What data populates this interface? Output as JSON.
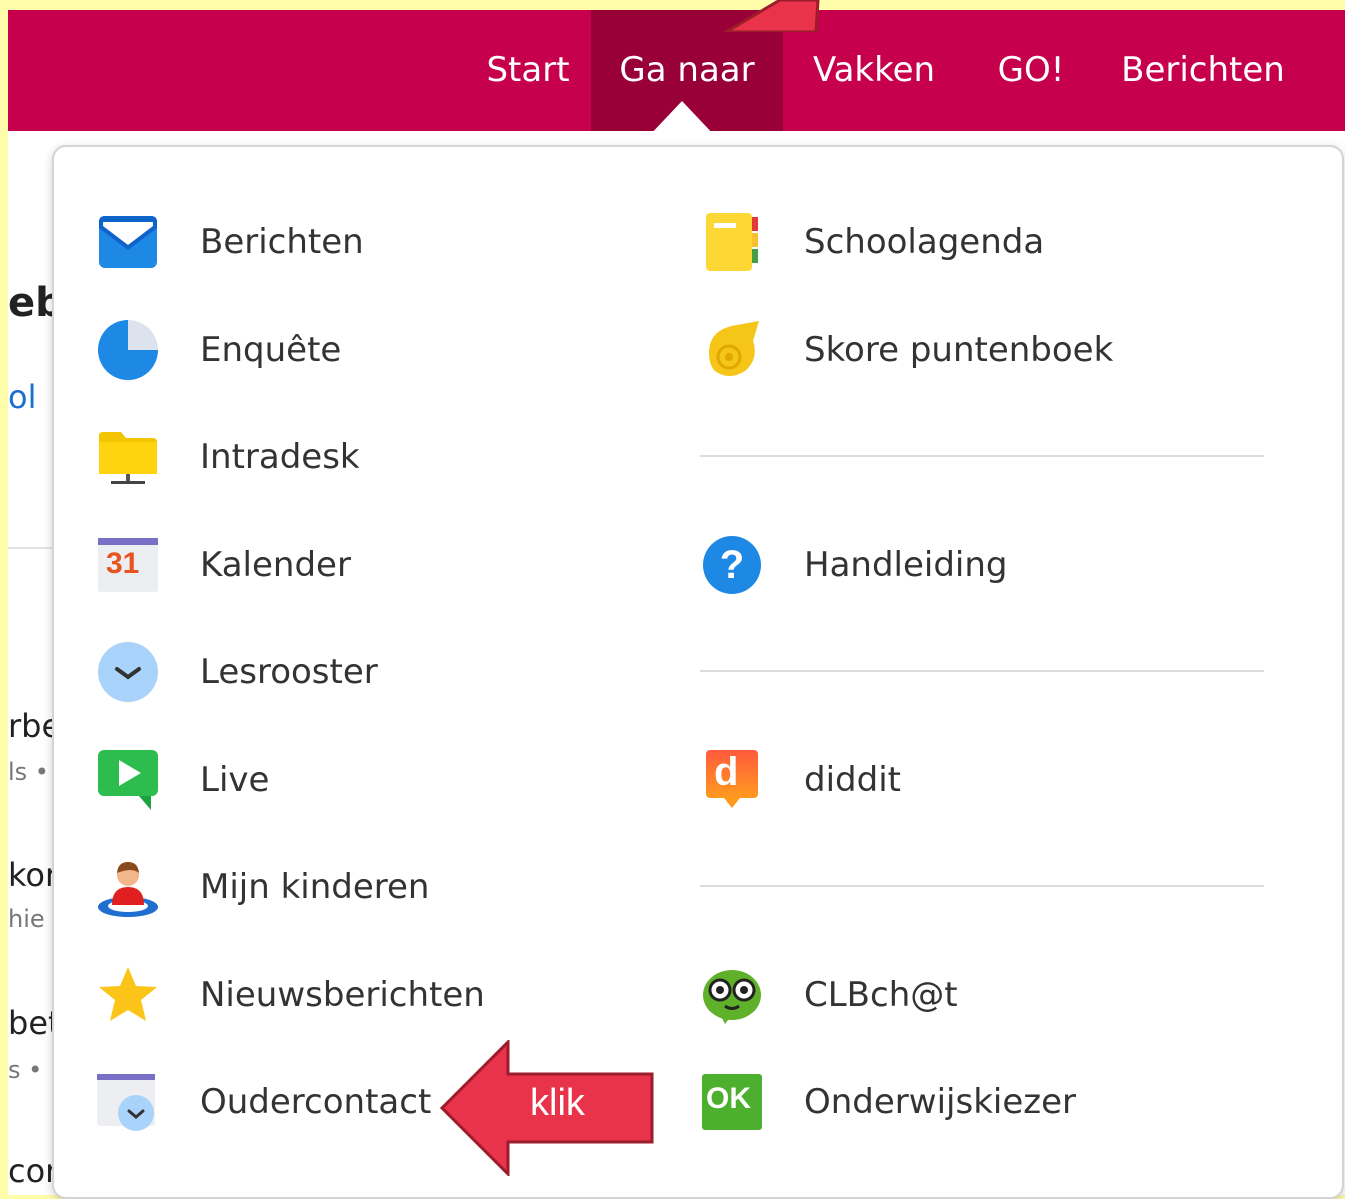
{
  "nav": {
    "items": [
      {
        "label": "Start"
      },
      {
        "label": "Ga naar"
      },
      {
        "label": "Vakken"
      },
      {
        "label": "GO!"
      },
      {
        "label": "Berichten"
      }
    ]
  },
  "background_fragments": [
    "eb",
    "ol",
    "rbe",
    "ls •",
    "kor",
    "hie",
    "bet",
    "s • ",
    "cor"
  ],
  "menu": {
    "left": [
      {
        "label": "Berichten",
        "icon": "envelope-icon"
      },
      {
        "label": "Enquête",
        "icon": "pie-chart-icon"
      },
      {
        "label": "Intradesk",
        "icon": "folder-icon"
      },
      {
        "label": "Kalender",
        "icon": "calendar-icon",
        "icon_text": "31"
      },
      {
        "label": "Lesrooster",
        "icon": "clock-icon"
      },
      {
        "label": "Live",
        "icon": "play-chat-icon"
      },
      {
        "label": "Mijn kinderen",
        "icon": "child-icon"
      },
      {
        "label": "Nieuwsberichten",
        "icon": "star-icon"
      },
      {
        "label": "Oudercontact",
        "icon": "calendar-clock-icon"
      }
    ],
    "right": [
      {
        "label": "Schoolagenda",
        "icon": "agenda-icon"
      },
      {
        "label": "Skore puntenboek",
        "icon": "shell-icon"
      },
      {
        "label": "Handleiding",
        "icon": "help-icon"
      },
      {
        "label": "diddit",
        "icon": "diddit-icon",
        "icon_text": "d"
      },
      {
        "label": "CLBch@t",
        "icon": "owl-icon"
      },
      {
        "label": "Onderwijskiezer",
        "icon": "ok-icon",
        "icon_text": "OK"
      }
    ]
  },
  "annotation": {
    "label": "klik",
    "color": "#e8334a"
  },
  "colors": {
    "brand": "#c6004d",
    "active": "#990038",
    "highlight": "#fffcaa"
  }
}
